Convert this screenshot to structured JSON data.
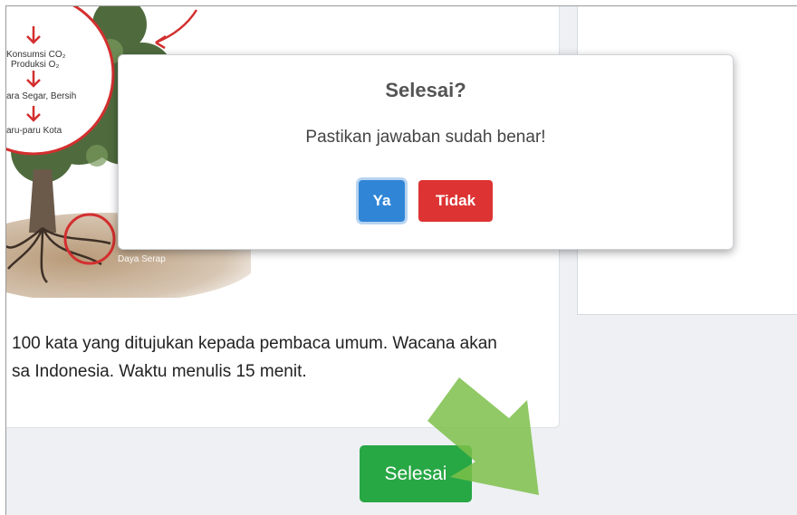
{
  "illustration": {
    "label_consumption": "Konsumsi CO₂",
    "label_production": "Produksi O₂",
    "label_fresh_air": "ara Segar, Bersih",
    "label_lungs": "aru-paru Kota",
    "label_absorption": "Daya Serap"
  },
  "article": {
    "line1": "100 kata yang ditujukan kepada pembaca umum. Wacana akan",
    "line2": "sa Indonesia. Waktu menulis 15 menit."
  },
  "footer": {
    "finish_label": "Selesai"
  },
  "dialog": {
    "title": "Selesai?",
    "message": "Pastikan jawaban sudah benar!",
    "confirm_label": "Ya",
    "cancel_label": "Tidak"
  },
  "colors": {
    "confirm": "#3085d6",
    "cancel": "#dd3333",
    "finish": "#28a745",
    "pointer_arrow": "#7cc04a"
  }
}
